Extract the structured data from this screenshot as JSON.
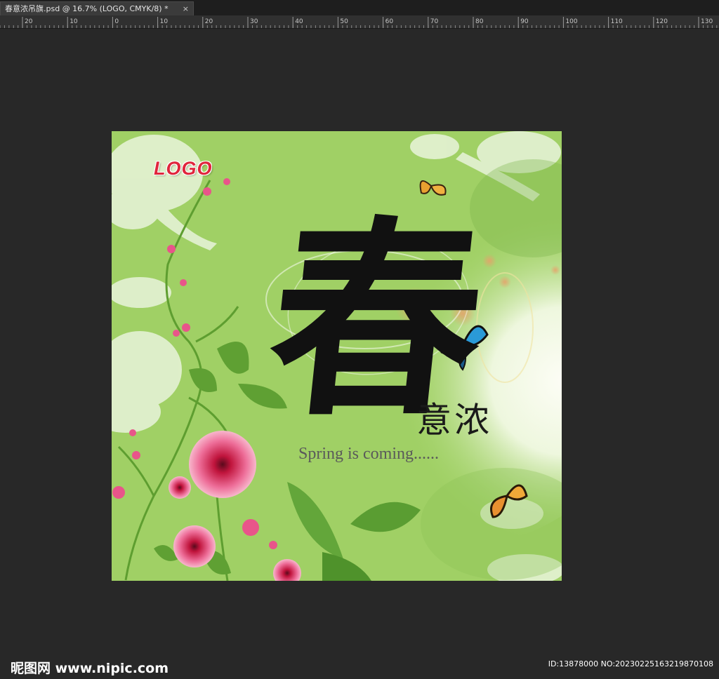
{
  "document_tab": {
    "title": "春意浓吊旗.psd @ 16.7% (LOGO, CMYK/8) *",
    "close_label": "×"
  },
  "ruler": {
    "labels": [
      "20",
      "10",
      "0",
      "10",
      "20",
      "30",
      "40",
      "50",
      "60",
      "70",
      "80",
      "90",
      "100",
      "110",
      "120",
      "130"
    ]
  },
  "artwork": {
    "logo": "LOGO",
    "main_character": "春",
    "sub_characters": "意浓",
    "tagline": "Spring is coming......",
    "colors": {
      "background": "#a8d66f",
      "light_glow": "#f6fbef",
      "flower_pink": "#e8558a",
      "butterfly_blue": "#2a9ad8",
      "butterfly_orange": "#e8a030"
    }
  },
  "watermark": {
    "site": "昵图网 www.nipic.com",
    "id_text": "ID:13878000 NO:20230225163219870108"
  },
  "colors": {
    "workspace": "#282828",
    "tab_bar": "#1e1e1e",
    "ruler": "#303030"
  }
}
